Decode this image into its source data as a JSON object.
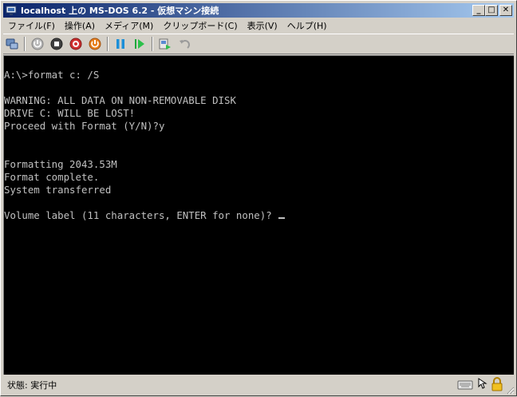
{
  "window": {
    "title": "localhost 上の MS-DOS 6.2 - 仮想マシン接続",
    "controls": {
      "minimize": "_",
      "maximize": "□",
      "close": "✕"
    }
  },
  "menu": {
    "items": [
      "ファイル(F)",
      "操作(A)",
      "メディア(M)",
      "クリップボード(C)",
      "表示(V)",
      "ヘルプ(H)"
    ]
  },
  "toolbar": {
    "icons": [
      "ctrl-alt-del-icon",
      "start-icon",
      "turn-off-icon",
      "shut-down-icon",
      "power-reset-icon",
      "pause-icon",
      "resume-icon",
      "snapshot-icon",
      "revert-icon"
    ]
  },
  "console": {
    "lines": [
      "A:\\>format c: /S",
      "",
      "WARNING: ALL DATA ON NON-REMOVABLE DISK",
      "DRIVE C: WILL BE LOST!",
      "Proceed with Format (Y/N)?y",
      "",
      "",
      "Formatting 2043.53M",
      "Format complete.",
      "System transferred",
      "",
      "Volume label (11 characters, ENTER for none)?"
    ]
  },
  "status": {
    "text": "状態: 実行中"
  },
  "colors": {
    "title_start": "#0a246a",
    "title_end": "#a6caf0",
    "console_bg": "#000000",
    "console_fg": "#c0c0c0"
  }
}
